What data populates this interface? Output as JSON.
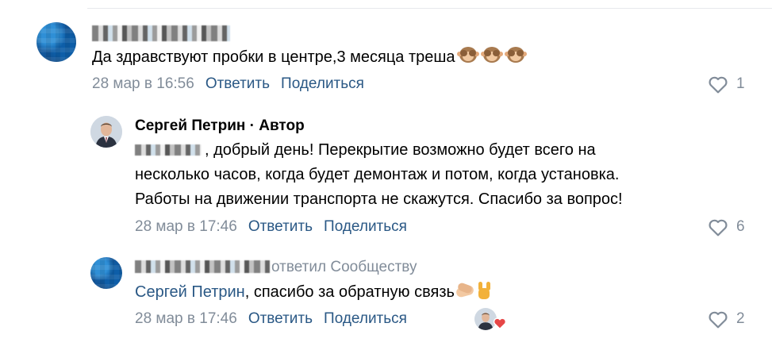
{
  "comments": [
    {
      "author_blurred": true,
      "text": "Да здравствуют пробки в центре,3 месяца треша",
      "emojis": [
        "see-no-evil-monkey",
        "see-no-evil-monkey",
        "see-no-evil-monkey"
      ],
      "date": "28 мар в 16:56",
      "reply_label": "Ответить",
      "share_label": "Поделиться",
      "likes": "1"
    },
    {
      "author": "Сергей Петрин · Автор",
      "text_line1_suffix": ", добрый день! Перекрытие возможно будет всего на",
      "text_line2": "несколько часов, когда будет демонтаж и потом, когда установка.",
      "text_line3": "Работы на движении транспорта не скажутся. Спасибо за вопрос!",
      "date": "28 мар в 17:46",
      "reply_label": "Ответить",
      "share_label": "Поделиться",
      "likes": "6"
    },
    {
      "author_blurred": true,
      "replied_to": "ответил Сообществу",
      "mention": "Сергей Петрин",
      "text": ", спасибо за обратную связь",
      "emojis": [
        "handshake",
        "sign-of-the-horns"
      ],
      "date": "28 мар в 17:46",
      "reply_label": "Ответить",
      "share_label": "Поделиться",
      "likes": "2",
      "author_reaction": "heart"
    }
  ],
  "colors": {
    "link": "#2a5885",
    "meta": "#818c99",
    "heart_reaction": "#e64646"
  }
}
